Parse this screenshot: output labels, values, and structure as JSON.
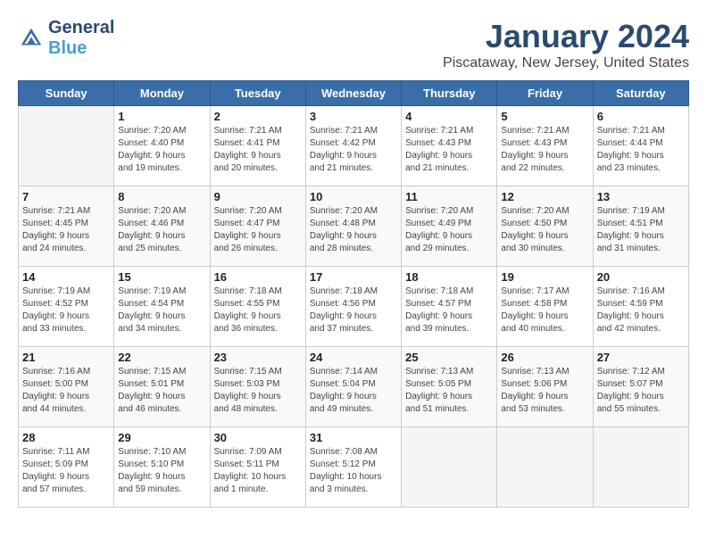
{
  "header": {
    "logo_line1": "General",
    "logo_line2": "Blue",
    "month": "January 2024",
    "location": "Piscataway, New Jersey, United States"
  },
  "days_of_week": [
    "Sunday",
    "Monday",
    "Tuesday",
    "Wednesday",
    "Thursday",
    "Friday",
    "Saturday"
  ],
  "weeks": [
    [
      {
        "day": "",
        "info": ""
      },
      {
        "day": "1",
        "info": "Sunrise: 7:20 AM\nSunset: 4:40 PM\nDaylight: 9 hours\nand 19 minutes."
      },
      {
        "day": "2",
        "info": "Sunrise: 7:21 AM\nSunset: 4:41 PM\nDaylight: 9 hours\nand 20 minutes."
      },
      {
        "day": "3",
        "info": "Sunrise: 7:21 AM\nSunset: 4:42 PM\nDaylight: 9 hours\nand 21 minutes."
      },
      {
        "day": "4",
        "info": "Sunrise: 7:21 AM\nSunset: 4:43 PM\nDaylight: 9 hours\nand 21 minutes."
      },
      {
        "day": "5",
        "info": "Sunrise: 7:21 AM\nSunset: 4:43 PM\nDaylight: 9 hours\nand 22 minutes."
      },
      {
        "day": "6",
        "info": "Sunrise: 7:21 AM\nSunset: 4:44 PM\nDaylight: 9 hours\nand 23 minutes."
      }
    ],
    [
      {
        "day": "7",
        "info": "Sunrise: 7:21 AM\nSunset: 4:45 PM\nDaylight: 9 hours\nand 24 minutes."
      },
      {
        "day": "8",
        "info": "Sunrise: 7:20 AM\nSunset: 4:46 PM\nDaylight: 9 hours\nand 25 minutes."
      },
      {
        "day": "9",
        "info": "Sunrise: 7:20 AM\nSunset: 4:47 PM\nDaylight: 9 hours\nand 26 minutes."
      },
      {
        "day": "10",
        "info": "Sunrise: 7:20 AM\nSunset: 4:48 PM\nDaylight: 9 hours\nand 28 minutes."
      },
      {
        "day": "11",
        "info": "Sunrise: 7:20 AM\nSunset: 4:49 PM\nDaylight: 9 hours\nand 29 minutes."
      },
      {
        "day": "12",
        "info": "Sunrise: 7:20 AM\nSunset: 4:50 PM\nDaylight: 9 hours\nand 30 minutes."
      },
      {
        "day": "13",
        "info": "Sunrise: 7:19 AM\nSunset: 4:51 PM\nDaylight: 9 hours\nand 31 minutes."
      }
    ],
    [
      {
        "day": "14",
        "info": "Sunrise: 7:19 AM\nSunset: 4:52 PM\nDaylight: 9 hours\nand 33 minutes."
      },
      {
        "day": "15",
        "info": "Sunrise: 7:19 AM\nSunset: 4:54 PM\nDaylight: 9 hours\nand 34 minutes."
      },
      {
        "day": "16",
        "info": "Sunrise: 7:18 AM\nSunset: 4:55 PM\nDaylight: 9 hours\nand 36 minutes."
      },
      {
        "day": "17",
        "info": "Sunrise: 7:18 AM\nSunset: 4:56 PM\nDaylight: 9 hours\nand 37 minutes."
      },
      {
        "day": "18",
        "info": "Sunrise: 7:18 AM\nSunset: 4:57 PM\nDaylight: 9 hours\nand 39 minutes."
      },
      {
        "day": "19",
        "info": "Sunrise: 7:17 AM\nSunset: 4:58 PM\nDaylight: 9 hours\nand 40 minutes."
      },
      {
        "day": "20",
        "info": "Sunrise: 7:16 AM\nSunset: 4:59 PM\nDaylight: 9 hours\nand 42 minutes."
      }
    ],
    [
      {
        "day": "21",
        "info": "Sunrise: 7:16 AM\nSunset: 5:00 PM\nDaylight: 9 hours\nand 44 minutes."
      },
      {
        "day": "22",
        "info": "Sunrise: 7:15 AM\nSunset: 5:01 PM\nDaylight: 9 hours\nand 46 minutes."
      },
      {
        "day": "23",
        "info": "Sunrise: 7:15 AM\nSunset: 5:03 PM\nDaylight: 9 hours\nand 48 minutes."
      },
      {
        "day": "24",
        "info": "Sunrise: 7:14 AM\nSunset: 5:04 PM\nDaylight: 9 hours\nand 49 minutes."
      },
      {
        "day": "25",
        "info": "Sunrise: 7:13 AM\nSunset: 5:05 PM\nDaylight: 9 hours\nand 51 minutes."
      },
      {
        "day": "26",
        "info": "Sunrise: 7:13 AM\nSunset: 5:06 PM\nDaylight: 9 hours\nand 53 minutes."
      },
      {
        "day": "27",
        "info": "Sunrise: 7:12 AM\nSunset: 5:07 PM\nDaylight: 9 hours\nand 55 minutes."
      }
    ],
    [
      {
        "day": "28",
        "info": "Sunrise: 7:11 AM\nSunset: 5:09 PM\nDaylight: 9 hours\nand 57 minutes."
      },
      {
        "day": "29",
        "info": "Sunrise: 7:10 AM\nSunset: 5:10 PM\nDaylight: 9 hours\nand 59 minutes."
      },
      {
        "day": "30",
        "info": "Sunrise: 7:09 AM\nSunset: 5:11 PM\nDaylight: 10 hours\nand 1 minute."
      },
      {
        "day": "31",
        "info": "Sunrise: 7:08 AM\nSunset: 5:12 PM\nDaylight: 10 hours\nand 3 minutes."
      },
      {
        "day": "",
        "info": ""
      },
      {
        "day": "",
        "info": ""
      },
      {
        "day": "",
        "info": ""
      }
    ]
  ]
}
